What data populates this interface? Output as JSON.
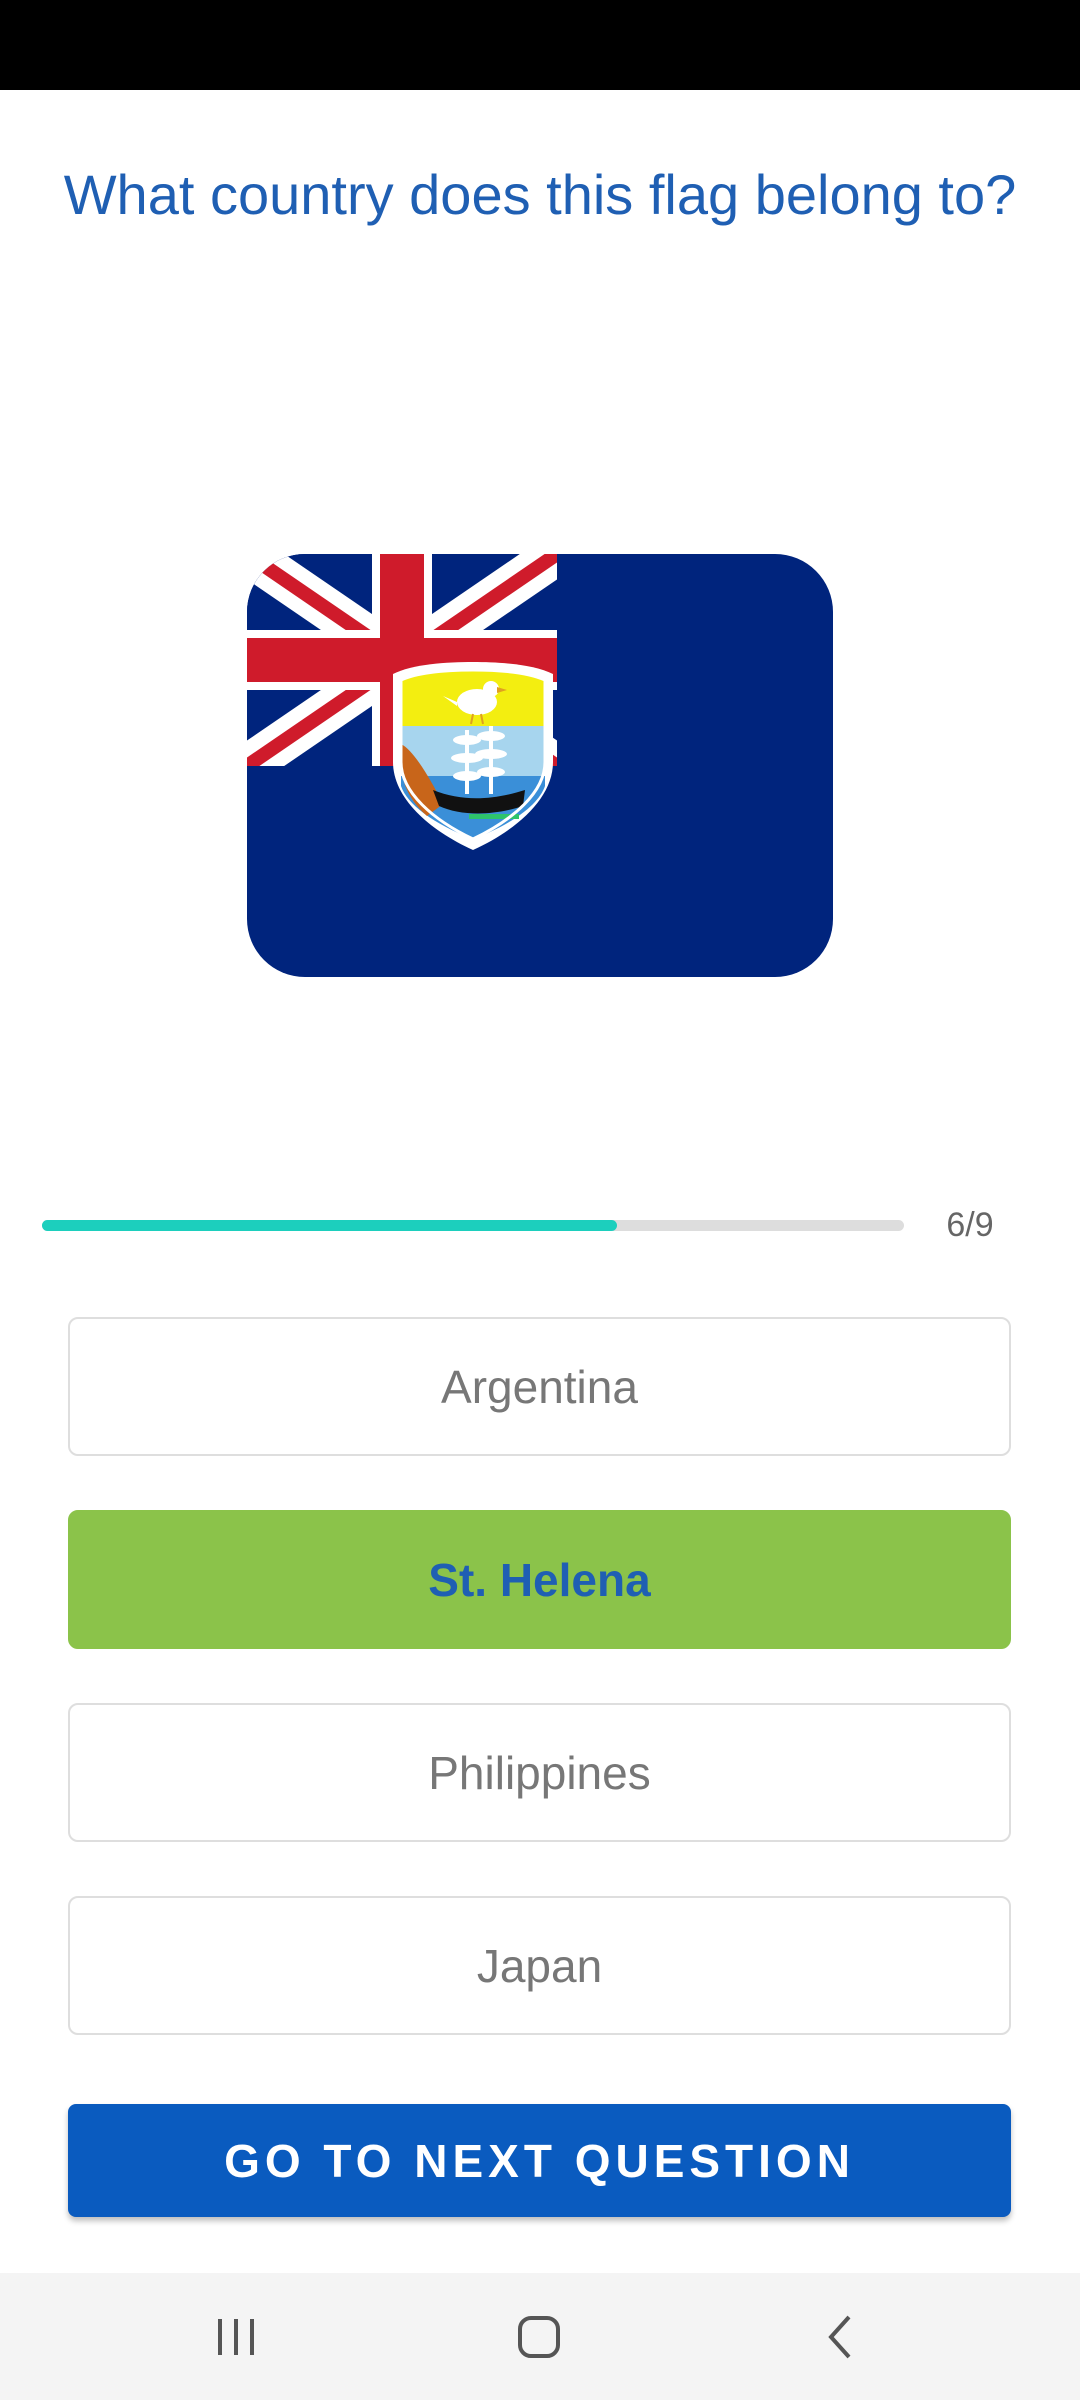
{
  "question": "What country does this flag belong to?",
  "flag": {
    "icon": "st-helena-flag-icon",
    "colors": {
      "field": "#00247d",
      "red": "#cf1b2b",
      "white": "#ffffff"
    }
  },
  "progress": {
    "current": 6,
    "total": 9,
    "fraction": 0.667,
    "label": "6/9",
    "fill_color": "#1ccfbd"
  },
  "options": [
    {
      "label": "Argentina",
      "state": "default"
    },
    {
      "label": "St. Helena",
      "state": "correct"
    },
    {
      "label": "Philippines",
      "state": "default"
    },
    {
      "label": "Japan",
      "state": "default"
    }
  ],
  "next_button": {
    "label": "GO TO NEXT QUESTION"
  },
  "colors": {
    "accent": "#1f5fb3",
    "button": "#0a5bbf",
    "correct": "#8bc34a"
  },
  "nav": {
    "recents_icon": "recent-apps-icon",
    "home_icon": "home-icon",
    "back_icon": "back-icon"
  }
}
